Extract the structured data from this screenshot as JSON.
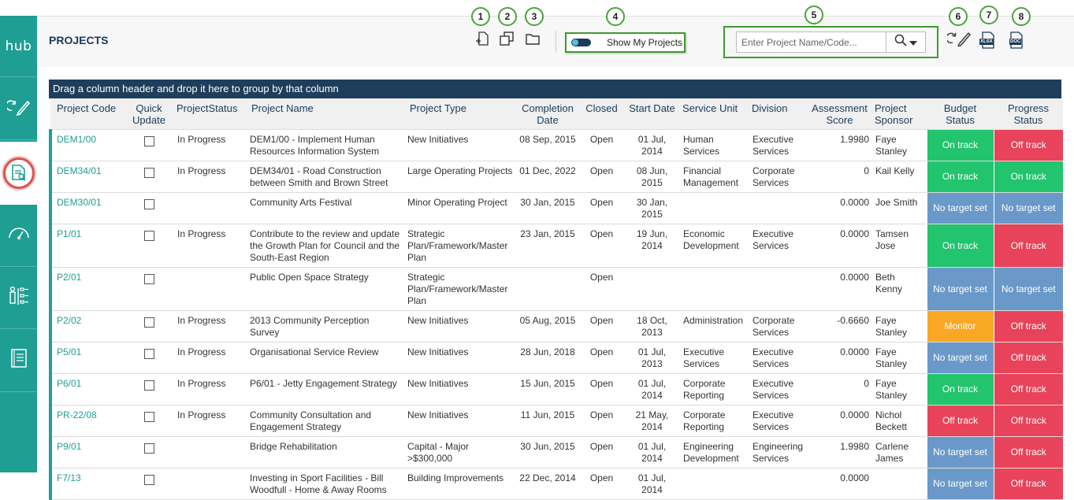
{
  "sidebar": {
    "logo": "hub",
    "items": [
      {
        "icon": "update-pencil-icon"
      },
      {
        "icon": "project-document-icon",
        "active": true
      },
      {
        "icon": "dashboard-gauge-icon"
      },
      {
        "icon": "org-hierarchy-icon"
      },
      {
        "icon": "report-book-icon"
      }
    ]
  },
  "header": {
    "title": "PROJECTS",
    "toggle_label": "Show My Projects",
    "search_placeholder": "Enter Project Name/Code...",
    "callouts": [
      "1",
      "2",
      "3",
      "4",
      "5",
      "6",
      "7",
      "8"
    ],
    "export_xlsx": "XLSX",
    "export_doc": "DOC"
  },
  "grid": {
    "group_hint": "Drag a column header and drop it here to group by that column",
    "columns": [
      "Project Code",
      "Quick Update",
      "ProjectStatus",
      "Project Name",
      "Project Type",
      "Completion Date",
      "Closed",
      "Start Date",
      "Service Unit",
      "Division",
      "Assessment Score",
      "Project Sponsor",
      "Budget Status",
      "Progress Status"
    ],
    "rows": [
      {
        "code": "DEM1/00",
        "status": "In Progress",
        "name": "DEM1/00 - Implement Human Resources Information System",
        "type": "New Initiatives",
        "completion": "08 Sep, 2015",
        "closed": "Open",
        "start": "01 Jul, 2014",
        "unit": "Human Services",
        "division": "Executive Services",
        "score": "1.9980",
        "sponsor": "Faye Stanley",
        "budget": "On track",
        "budget_color": "green",
        "progress": "Off track",
        "progress_color": "red"
      },
      {
        "code": "DEM34/01",
        "status": "In Progress",
        "name": "DEM34/01 - Road Construction between Smith and Brown Street",
        "type": "Large Operating Projects",
        "completion": "01 Dec, 2022",
        "closed": "Open",
        "start": "08 Jun, 2015",
        "unit": "Financial Management",
        "division": "Corporate Services",
        "score": "0",
        "sponsor": "Kail Kelly",
        "budget": "On track",
        "budget_color": "green",
        "progress": "On track",
        "progress_color": "green"
      },
      {
        "code": "DEM30/01",
        "status": "",
        "name": "Community Arts Festival",
        "type": "Minor Operating Project",
        "completion": "30 Jan, 2015",
        "closed": "Open",
        "start": "30 Jan, 2015",
        "unit": "",
        "division": "",
        "score": "0.0000",
        "sponsor": "Joe Smith",
        "budget": "No target set",
        "budget_color": "blue",
        "progress": "No target set",
        "progress_color": "blue"
      },
      {
        "code": "P1/01",
        "status": "In Progress",
        "name": "Contribute to the review and update the Growth Plan for Council and the South-East Region",
        "type": "Strategic Plan/Framework/Master Plan",
        "completion": "23 Jan, 2015",
        "closed": "Open",
        "start": "19 Jun, 2014",
        "unit": "Economic Development",
        "division": "Executive Services",
        "score": "0.0000",
        "sponsor": "Tamsen Jose",
        "budget": "On track",
        "budget_color": "green",
        "progress": "Off track",
        "progress_color": "red"
      },
      {
        "code": "P2/01",
        "status": "",
        "name": "Public Open Space Strategy",
        "type": "Strategic Plan/Framework/Master Plan",
        "completion": "",
        "closed": "Open",
        "start": "",
        "unit": "",
        "division": "",
        "score": "0.0000",
        "sponsor": "Beth Kenny",
        "budget": "No target set",
        "budget_color": "blue",
        "progress": "No target set",
        "progress_color": "blue"
      },
      {
        "code": "P2/02",
        "status": "In Progress",
        "name": "2013 Community Perception Survey",
        "type": "New Initiatives",
        "completion": "05 Aug, 2015",
        "closed": "Open",
        "start": "18 Oct, 2013",
        "unit": "Administration",
        "division": "Corporate Services",
        "score": "-0.6660",
        "sponsor": "Faye Stanley",
        "budget": "Monitor",
        "budget_color": "orange",
        "progress": "Off track",
        "progress_color": "red"
      },
      {
        "code": "P5/01",
        "status": "In Progress",
        "name": "Organisational Service Review",
        "type": "New Initiatives",
        "completion": "28 Jun, 2018",
        "closed": "Open",
        "start": "01 Jul, 2013",
        "unit": "Executive Services",
        "division": "Executive Services",
        "score": "0.0000",
        "sponsor": "Faye Stanley",
        "budget": "No target set",
        "budget_color": "blue",
        "progress": "Off track",
        "progress_color": "red"
      },
      {
        "code": "P6/01",
        "status": "In Progress",
        "name": "P6/01 - Jetty Engagement Strategy",
        "type": "New Initiatives",
        "completion": "15 Jun, 2015",
        "closed": "Open",
        "start": "01 Jul, 2014",
        "unit": "Corporate Reporting",
        "division": "Executive Services",
        "score": "0",
        "sponsor": "Faye Stanley",
        "budget": "On track",
        "budget_color": "green",
        "progress": "Off track",
        "progress_color": "red"
      },
      {
        "code": "PR-22/08",
        "status": "In Progress",
        "name": "Community Consultation and Engagement Strategy",
        "type": "New Initiatives",
        "completion": "11 Jun, 2015",
        "closed": "Open",
        "start": "21 May, 2014",
        "unit": "Corporate Reporting",
        "division": "Executive Services",
        "score": "0.0000",
        "sponsor": "Nichol Beckett",
        "budget": "Off track",
        "budget_color": "red",
        "progress": "Off track",
        "progress_color": "red"
      },
      {
        "code": "P9/01",
        "status": "",
        "name": "Bridge Rehabilitation",
        "type": "Capital - Major >$300,000",
        "completion": "30 Jun, 2015",
        "closed": "Open",
        "start": "01 Jul, 2014",
        "unit": "Engineering Development",
        "division": "Engineering Services",
        "score": "1.9980",
        "sponsor": "Carlene James",
        "budget": "No target set",
        "budget_color": "blue",
        "progress": "Off track",
        "progress_color": "red"
      },
      {
        "code": "F7/13",
        "status": "",
        "name": "Investing in Sport Facilities - Bill Woodfull - Home & Away Rooms",
        "type": "Building Improvements",
        "completion": "22 Dec, 2014",
        "closed": "Open",
        "start": "01 Jul, 2014",
        "unit": "",
        "division": "",
        "score": "0.0000",
        "sponsor": "",
        "budget": "No target set",
        "budget_color": "blue",
        "progress": "Off track",
        "progress_color": "red"
      }
    ]
  }
}
